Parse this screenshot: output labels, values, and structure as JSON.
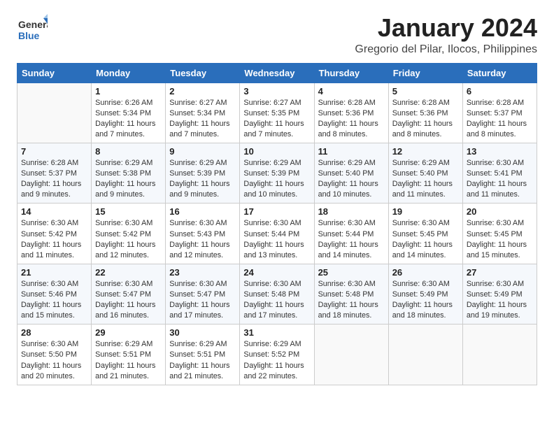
{
  "header": {
    "logo_general": "General",
    "logo_blue": "Blue",
    "title": "January 2024",
    "subtitle": "Gregorio del Pilar, Ilocos, Philippines"
  },
  "weekdays": [
    "Sunday",
    "Monday",
    "Tuesday",
    "Wednesday",
    "Thursday",
    "Friday",
    "Saturday"
  ],
  "weeks": [
    [
      {
        "day": "",
        "info": ""
      },
      {
        "day": "1",
        "info": "Sunrise: 6:26 AM\nSunset: 5:34 PM\nDaylight: 11 hours\nand 7 minutes."
      },
      {
        "day": "2",
        "info": "Sunrise: 6:27 AM\nSunset: 5:34 PM\nDaylight: 11 hours\nand 7 minutes."
      },
      {
        "day": "3",
        "info": "Sunrise: 6:27 AM\nSunset: 5:35 PM\nDaylight: 11 hours\nand 7 minutes."
      },
      {
        "day": "4",
        "info": "Sunrise: 6:28 AM\nSunset: 5:36 PM\nDaylight: 11 hours\nand 8 minutes."
      },
      {
        "day": "5",
        "info": "Sunrise: 6:28 AM\nSunset: 5:36 PM\nDaylight: 11 hours\nand 8 minutes."
      },
      {
        "day": "6",
        "info": "Sunrise: 6:28 AM\nSunset: 5:37 PM\nDaylight: 11 hours\nand 8 minutes."
      }
    ],
    [
      {
        "day": "7",
        "info": "Sunrise: 6:28 AM\nSunset: 5:37 PM\nDaylight: 11 hours\nand 9 minutes."
      },
      {
        "day": "8",
        "info": "Sunrise: 6:29 AM\nSunset: 5:38 PM\nDaylight: 11 hours\nand 9 minutes."
      },
      {
        "day": "9",
        "info": "Sunrise: 6:29 AM\nSunset: 5:39 PM\nDaylight: 11 hours\nand 9 minutes."
      },
      {
        "day": "10",
        "info": "Sunrise: 6:29 AM\nSunset: 5:39 PM\nDaylight: 11 hours\nand 10 minutes."
      },
      {
        "day": "11",
        "info": "Sunrise: 6:29 AM\nSunset: 5:40 PM\nDaylight: 11 hours\nand 10 minutes."
      },
      {
        "day": "12",
        "info": "Sunrise: 6:29 AM\nSunset: 5:40 PM\nDaylight: 11 hours\nand 11 minutes."
      },
      {
        "day": "13",
        "info": "Sunrise: 6:30 AM\nSunset: 5:41 PM\nDaylight: 11 hours\nand 11 minutes."
      }
    ],
    [
      {
        "day": "14",
        "info": "Sunrise: 6:30 AM\nSunset: 5:42 PM\nDaylight: 11 hours\nand 11 minutes."
      },
      {
        "day": "15",
        "info": "Sunrise: 6:30 AM\nSunset: 5:42 PM\nDaylight: 11 hours\nand 12 minutes."
      },
      {
        "day": "16",
        "info": "Sunrise: 6:30 AM\nSunset: 5:43 PM\nDaylight: 11 hours\nand 12 minutes."
      },
      {
        "day": "17",
        "info": "Sunrise: 6:30 AM\nSunset: 5:44 PM\nDaylight: 11 hours\nand 13 minutes."
      },
      {
        "day": "18",
        "info": "Sunrise: 6:30 AM\nSunset: 5:44 PM\nDaylight: 11 hours\nand 14 minutes."
      },
      {
        "day": "19",
        "info": "Sunrise: 6:30 AM\nSunset: 5:45 PM\nDaylight: 11 hours\nand 14 minutes."
      },
      {
        "day": "20",
        "info": "Sunrise: 6:30 AM\nSunset: 5:45 PM\nDaylight: 11 hours\nand 15 minutes."
      }
    ],
    [
      {
        "day": "21",
        "info": "Sunrise: 6:30 AM\nSunset: 5:46 PM\nDaylight: 11 hours\nand 15 minutes."
      },
      {
        "day": "22",
        "info": "Sunrise: 6:30 AM\nSunset: 5:47 PM\nDaylight: 11 hours\nand 16 minutes."
      },
      {
        "day": "23",
        "info": "Sunrise: 6:30 AM\nSunset: 5:47 PM\nDaylight: 11 hours\nand 17 minutes."
      },
      {
        "day": "24",
        "info": "Sunrise: 6:30 AM\nSunset: 5:48 PM\nDaylight: 11 hours\nand 17 minutes."
      },
      {
        "day": "25",
        "info": "Sunrise: 6:30 AM\nSunset: 5:48 PM\nDaylight: 11 hours\nand 18 minutes."
      },
      {
        "day": "26",
        "info": "Sunrise: 6:30 AM\nSunset: 5:49 PM\nDaylight: 11 hours\nand 18 minutes."
      },
      {
        "day": "27",
        "info": "Sunrise: 6:30 AM\nSunset: 5:49 PM\nDaylight: 11 hours\nand 19 minutes."
      }
    ],
    [
      {
        "day": "28",
        "info": "Sunrise: 6:30 AM\nSunset: 5:50 PM\nDaylight: 11 hours\nand 20 minutes."
      },
      {
        "day": "29",
        "info": "Sunrise: 6:29 AM\nSunset: 5:51 PM\nDaylight: 11 hours\nand 21 minutes."
      },
      {
        "day": "30",
        "info": "Sunrise: 6:29 AM\nSunset: 5:51 PM\nDaylight: 11 hours\nand 21 minutes."
      },
      {
        "day": "31",
        "info": "Sunrise: 6:29 AM\nSunset: 5:52 PM\nDaylight: 11 hours\nand 22 minutes."
      },
      {
        "day": "",
        "info": ""
      },
      {
        "day": "",
        "info": ""
      },
      {
        "day": "",
        "info": ""
      }
    ]
  ]
}
